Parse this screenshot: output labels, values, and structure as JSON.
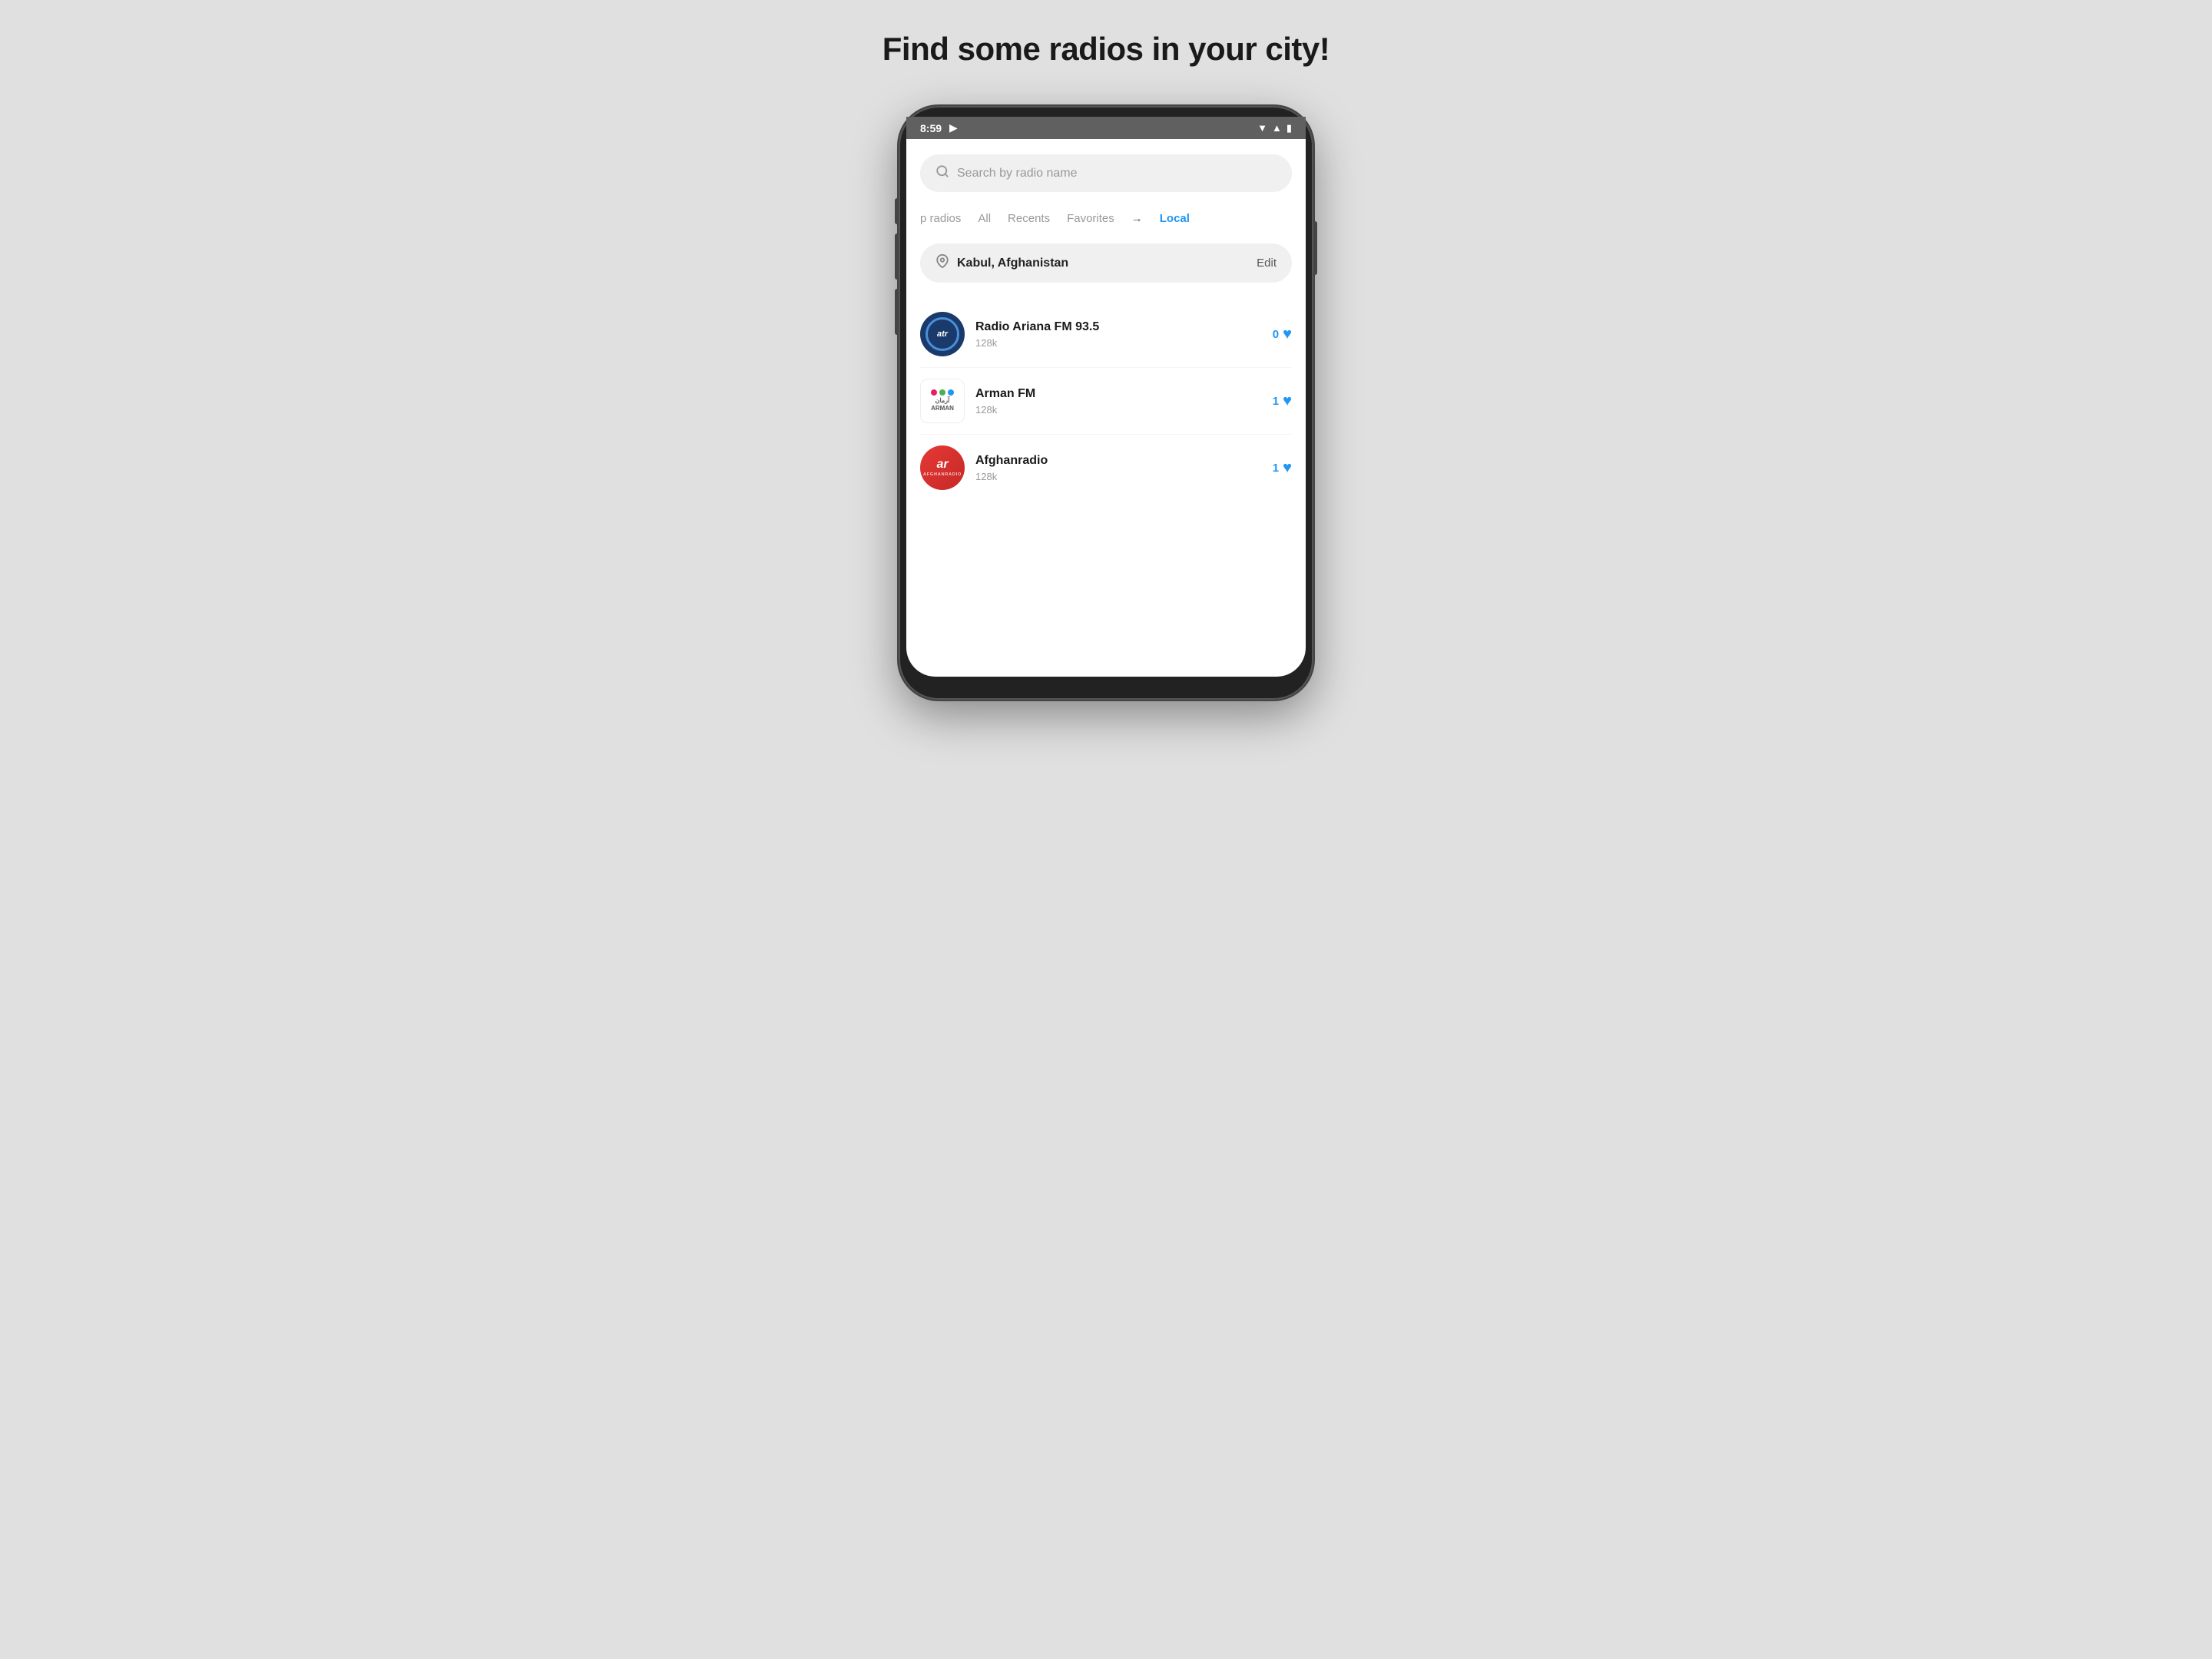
{
  "page": {
    "title": "Find some radios in your city!",
    "background_color": "#e0e0e0"
  },
  "status_bar": {
    "time": "8:59",
    "play_indicator": "▶",
    "wifi_icon": "wifi",
    "signal_icon": "signal",
    "battery_icon": "battery"
  },
  "search": {
    "placeholder": "Search by radio name"
  },
  "tabs": [
    {
      "label": "p radios",
      "active": false
    },
    {
      "label": "All",
      "active": false
    },
    {
      "label": "Recents",
      "active": false
    },
    {
      "label": "Favorites",
      "active": false
    },
    {
      "label": "Local",
      "active": true
    }
  ],
  "location": {
    "name": "Kabul, Afghanistan",
    "edit_label": "Edit"
  },
  "radios": [
    {
      "name": "Radio Ariana FM 93.5",
      "bitrate": "128k",
      "favorites": "0",
      "logo_type": "ariana"
    },
    {
      "name": "Arman FM",
      "bitrate": "128k",
      "favorites": "1",
      "logo_type": "arman"
    },
    {
      "name": "Afghanradio",
      "bitrate": "128k",
      "favorites": "1",
      "logo_type": "afghan"
    }
  ]
}
